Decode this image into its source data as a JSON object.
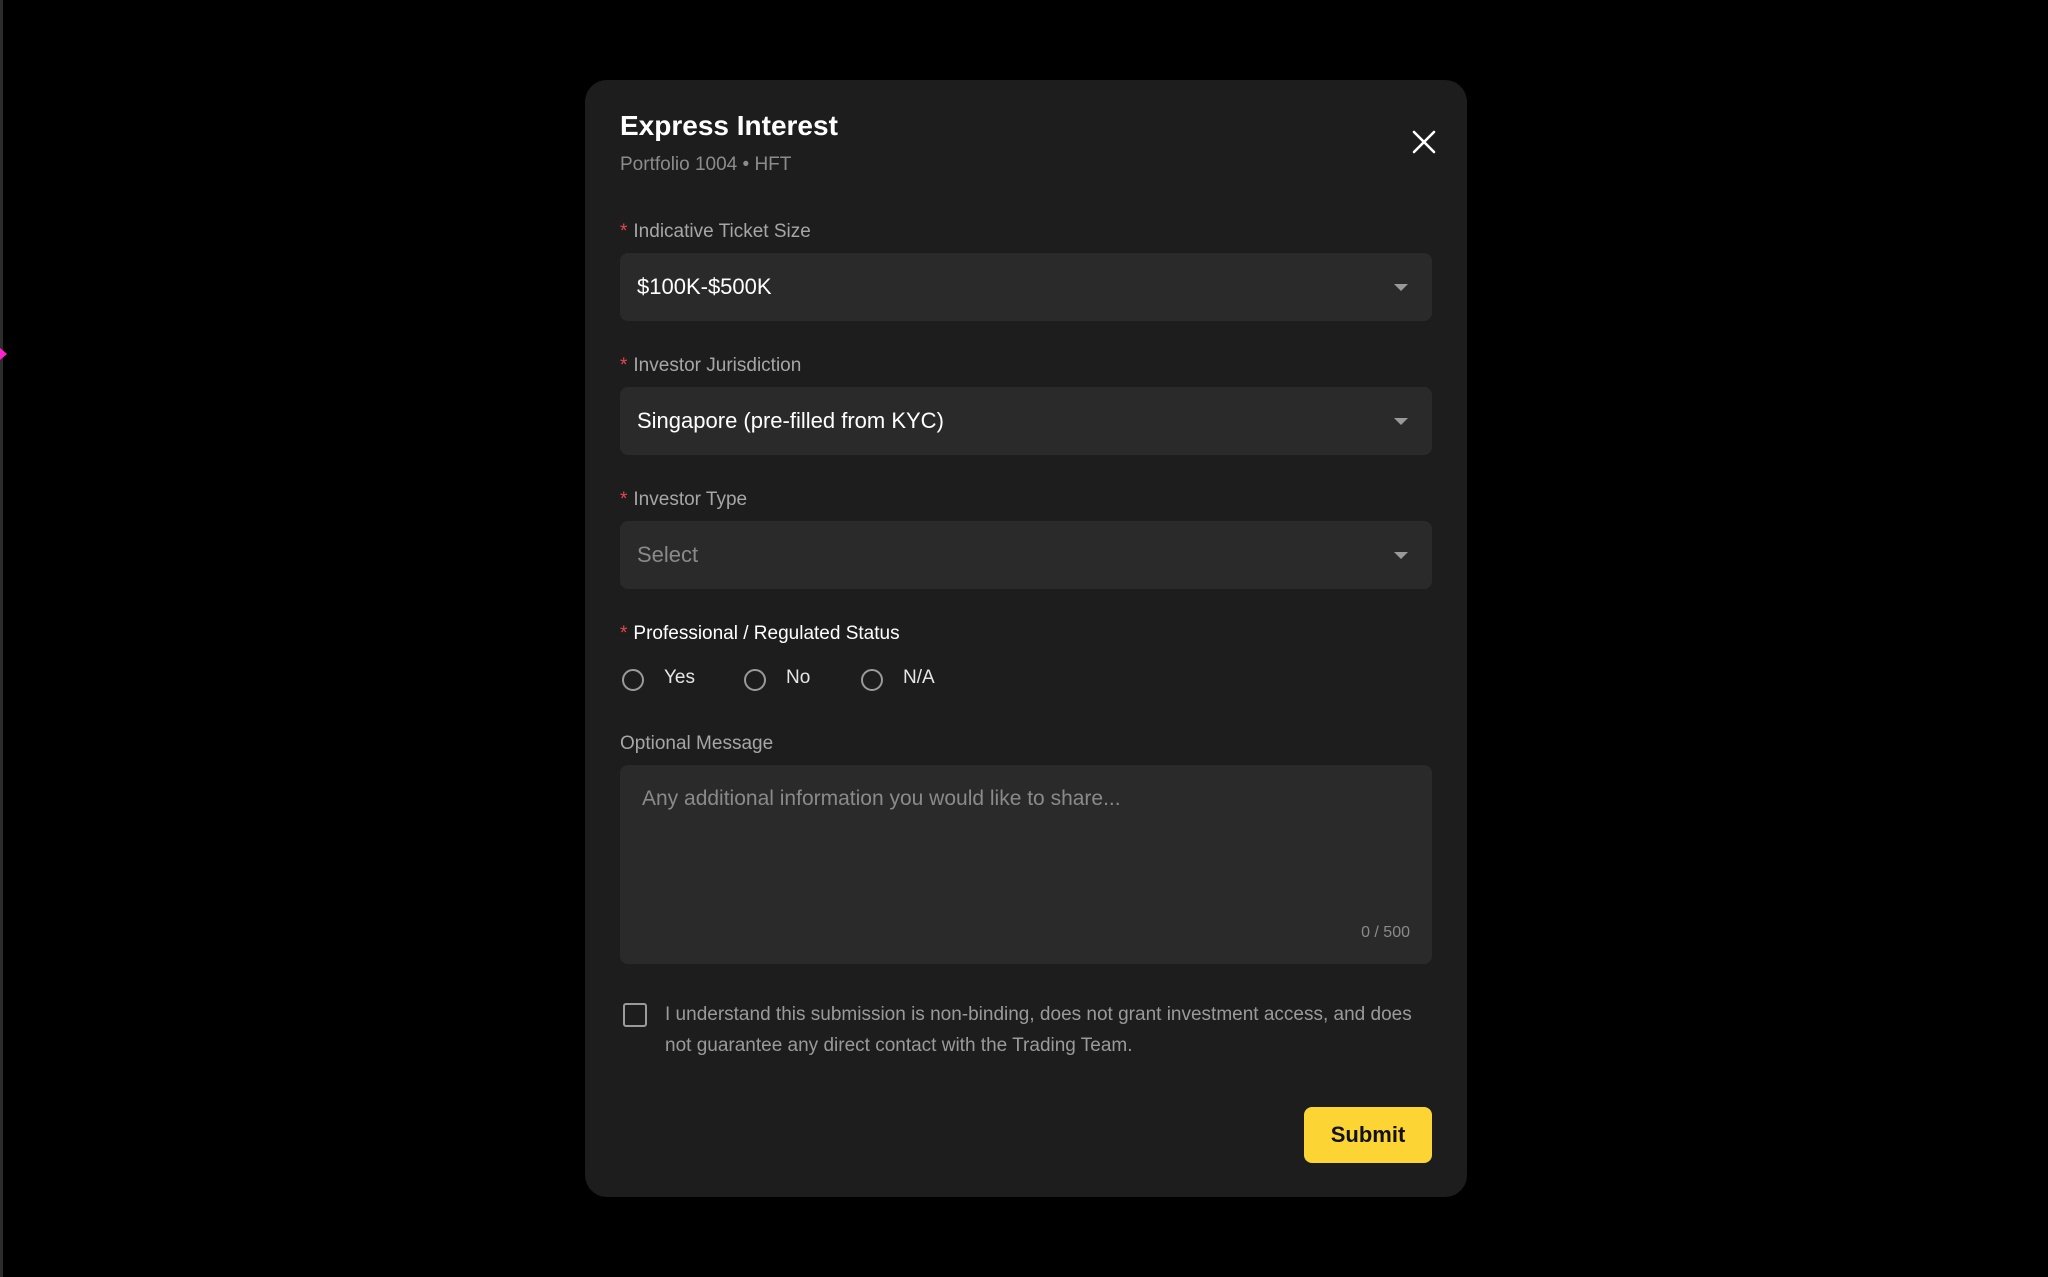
{
  "modal": {
    "title": "Express Interest",
    "subtitle": "Portfolio 1004 • HFT",
    "close_icon": "close-icon"
  },
  "fields": {
    "required_mark": "*",
    "ticket_size": {
      "label": "Indicative Ticket Size",
      "value": "$100K-$500K"
    },
    "jurisdiction": {
      "label": "Investor Jurisdiction",
      "value": "Singapore (pre-filled from KYC)"
    },
    "investor_type": {
      "label": "Investor Type",
      "placeholder": "Select"
    },
    "professional_status": {
      "label": "Professional / Regulated Status",
      "options": [
        {
          "label": "Yes",
          "selected": false
        },
        {
          "label": "No",
          "selected": false
        },
        {
          "label": "N/A",
          "selected": false
        }
      ]
    },
    "message": {
      "label": "Optional Message",
      "placeholder": "Any additional information you would like to share...",
      "counter": "0 / 500"
    }
  },
  "acknowledgement": {
    "checked": false,
    "text": "I understand this submission is non-binding, does not grant investment access, and does not guarantee any direct contact with the Trading Team."
  },
  "actions": {
    "submit_label": "Submit"
  },
  "colors": {
    "background": "#000000",
    "modal": "#1d1d1d",
    "field": "#2a2a2a",
    "accent": "#fcd535",
    "required": "#e5484d"
  }
}
